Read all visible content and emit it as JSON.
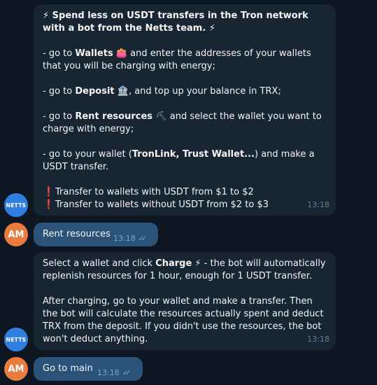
{
  "messages": {
    "m1": {
      "title_pre": "⚡ ",
      "title": "Spend less on USDT transfers in the Tron network with a bot from the Netts team.",
      "title_post": " ⚡",
      "l1_pre": "- go to ",
      "l1_bold": "Wallets",
      "l1_emoji": "👛",
      "l1_post": " and enter the addresses of your wallets that you will be charging with energy;",
      "l2_pre": "- go to ",
      "l2_bold": "Deposit",
      "l2_emoji": "🏦",
      "l2_post": ", and top up your balance in TRX;",
      "l3_pre": "- go to ",
      "l3_bold": "Rent resources",
      "l3_emoji": "⛏",
      "l3_post": " and select the wallet you want to charge with energy;",
      "l4_pre": "- go to your wallet (",
      "l4_bold": "TronLink, Trust Wallet...",
      "l4_post": ") and make a USDT transfer.",
      "w1": "Transfer to wallets with USDT from $1 to $2",
      "w2": "Transfer to wallets without USDT from $2 to $3",
      "time": "13:18"
    },
    "m2": {
      "text": "Rent resources",
      "time": "13:18"
    },
    "m3": {
      "p1_pre": "Select a wallet and click ",
      "p1_bold": "Charge",
      "p1_emoji": "⚡",
      "p1_post": " - the bot will automatically replenish resources for 1 hour, enough for 1 USDT transfer.",
      "p2": "After charging, go to your wallet and make a transfer. Then the bot will calculate the resources actually spent and deduct TRX from the deposit. If you didn't use the resources, the bot won't deduct anything.",
      "time": "13:18"
    },
    "m4": {
      "text": "Go to main",
      "time": "13:18"
    }
  },
  "avatars": {
    "bot": "NETTS",
    "user": "AM"
  },
  "icons": {
    "warning": "❗",
    "read_ticks": "✓✓"
  },
  "colors": {
    "bg": "#0e1621",
    "incoming": "#182533",
    "outgoing": "#2b5278",
    "bot_avatar": "#2f7fe0",
    "user_avatar": "#e87b3e"
  }
}
